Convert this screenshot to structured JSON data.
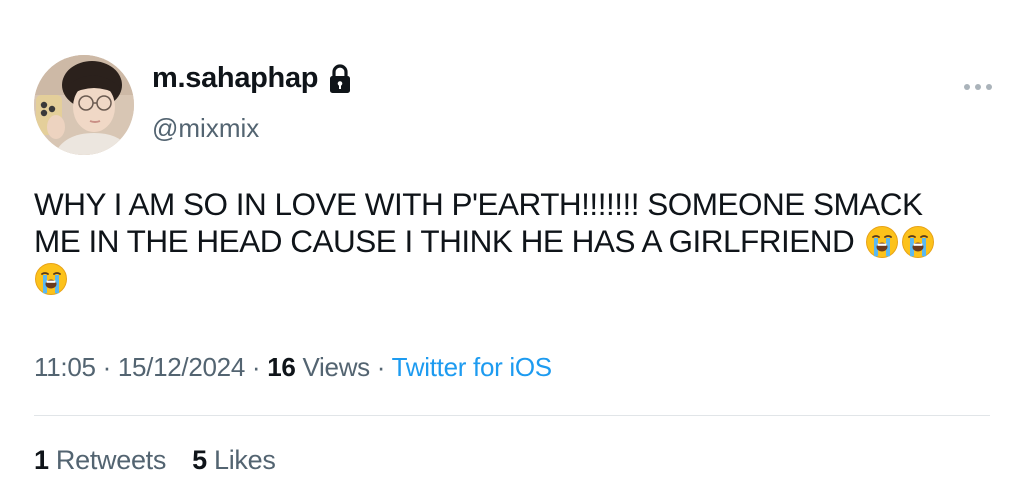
{
  "user": {
    "display_name": "m.sahaphap",
    "handle": "@mixmix",
    "avatar_icon": "profile-photo",
    "protected_icon": "lock-icon"
  },
  "tweet": {
    "lines": [
      "WHY I AM SO IN LOVE WITH P'EARTH!!!!!!! SOMEONE SMACK",
      "ME IN THE HEAD CAUSE I THINK HE HAS A GIRLFRIEND",
      ""
    ],
    "emoji": "loudly-crying-face"
  },
  "meta": {
    "time": "11:05",
    "separator": " · ",
    "date": "15/12/2024",
    "views_count": "16",
    "views_label": "Views",
    "source": "Twitter for iOS"
  },
  "stats": {
    "retweets_count": "1",
    "retweets_label": "Retweets",
    "likes_count": "5",
    "likes_label": "Likes"
  },
  "colors": {
    "text": "#0f1419",
    "secondary": "#536471",
    "link": "#1d9bf0",
    "divider": "#e1e5e8"
  }
}
